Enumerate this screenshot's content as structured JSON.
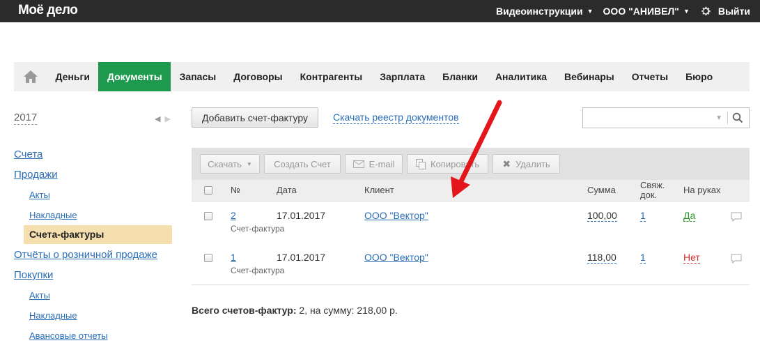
{
  "topbar": {
    "logo": "Моё дело",
    "video": "Видеоинструкции",
    "company": "ООО \"АНИВЕЛ\"",
    "logout": "Выйти"
  },
  "nav": {
    "items": [
      "Деньги",
      "Документы",
      "Запасы",
      "Договоры",
      "Контрагенты",
      "Зарплата",
      "Бланки",
      "Аналитика",
      "Вебинары",
      "Отчеты",
      "Бюро"
    ],
    "active_index": 1
  },
  "sidebar": {
    "year": "2017",
    "links": {
      "accounts": "Счета",
      "sales": "Продажи",
      "sales_acts": "Акты",
      "sales_waybills": "Накладные",
      "sales_invoices": "Счета-фактуры",
      "retail_reports": "Отчёты о розничной продаже",
      "purchases": "Покупки",
      "purch_acts": "Акты",
      "purch_waybills": "Накладные",
      "advance_reports": "Авансовые отчеты"
    }
  },
  "actions": {
    "add_button": "Добавить счет-фактуру",
    "download_registry": "Скачать реестр документов"
  },
  "toolbar": {
    "download": "Скачать",
    "create_invoice": "Создать Счет",
    "email": "E-mail",
    "copy": "Копировать",
    "delete": "Удалить"
  },
  "table": {
    "headers": {
      "num": "№",
      "date": "Дата",
      "client": "Клиент",
      "sum": "Сумма",
      "linked_1": "Свяж.",
      "linked_2": "док.",
      "on_hands": "На руках"
    },
    "rows": [
      {
        "num": "2",
        "type": "Счет-фактура",
        "date": "17.01.2017",
        "client": "ООО \"Вектор\"",
        "sum": "100,00",
        "linked": "1",
        "on_hands": "Да"
      },
      {
        "num": "1",
        "type": "Счет-фактура",
        "date": "17.01.2017",
        "client": "ООО \"Вектор\"",
        "sum": "118,00",
        "linked": "1",
        "on_hands": "Нет"
      }
    ]
  },
  "summary": {
    "label": "Всего счетов-фактур:",
    "text": "2, на сумму: 218,00 р."
  },
  "colors": {
    "accent_green": "#1e9a4f",
    "link_blue": "#2a6db5",
    "active_sidebar": "#f6dfae",
    "yes_green": "#2a9a2a",
    "no_red": "#d0312d",
    "arrow_red": "#e3161b"
  }
}
